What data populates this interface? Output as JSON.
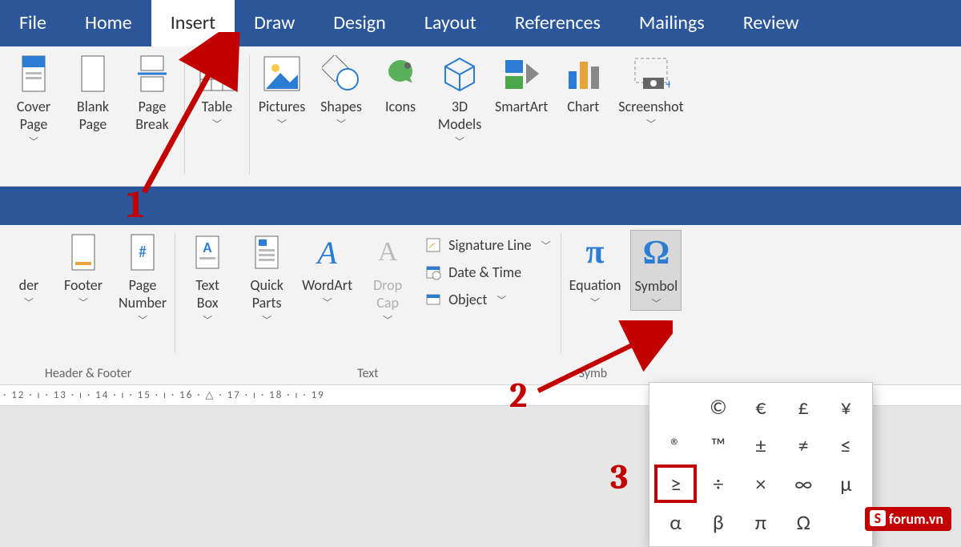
{
  "tabs": {
    "file": "File",
    "home": "Home",
    "insert": "Insert",
    "draw": "Draw",
    "design": "Design",
    "layout": "Layout",
    "references": "References",
    "mailings": "Mailings",
    "review": "Review"
  },
  "ribbon1": {
    "coverPage": "Cover\nPage",
    "blankPage": "Blank\nPage",
    "pageBreak": "Page\nBreak",
    "table": "Table",
    "pictures": "Pictures",
    "shapes": "Shapes",
    "icons": "Icons",
    "models3d": "3D\nModels",
    "smartArt": "SmartArt",
    "chart": "Chart",
    "screenshot": "Screenshot"
  },
  "ribbon2": {
    "header": "der",
    "footer": "Footer",
    "pageNumber": "Page\nNumber",
    "groupHeaderFooter": "Header & Footer",
    "textBox": "Text\nBox",
    "quickParts": "Quick\nParts",
    "wordArt": "WordArt",
    "dropCap": "Drop\nCap",
    "signatureLine": "Signature Line",
    "dateTime": "Date & Time",
    "object": "Object",
    "groupText": "Text",
    "equation": "Equation",
    "symbol": "Symbol",
    "groupSymbols": "Symb"
  },
  "ruler": "· 12 · ı · 13 · ı · 14 · ı · 15 · ı · 16 · △ · 17 · ı · 18 · ı · 19",
  "symbols": [
    "©",
    "€",
    "£",
    "¥",
    "®",
    "™",
    "±",
    "≠",
    "≤",
    "≥",
    "÷",
    "×",
    "∞",
    "µ",
    "α",
    "β",
    "π",
    "Ω"
  ],
  "annotations": {
    "a1": "1",
    "a2": "2",
    "a3": "3"
  },
  "watermark": "forum.vn"
}
